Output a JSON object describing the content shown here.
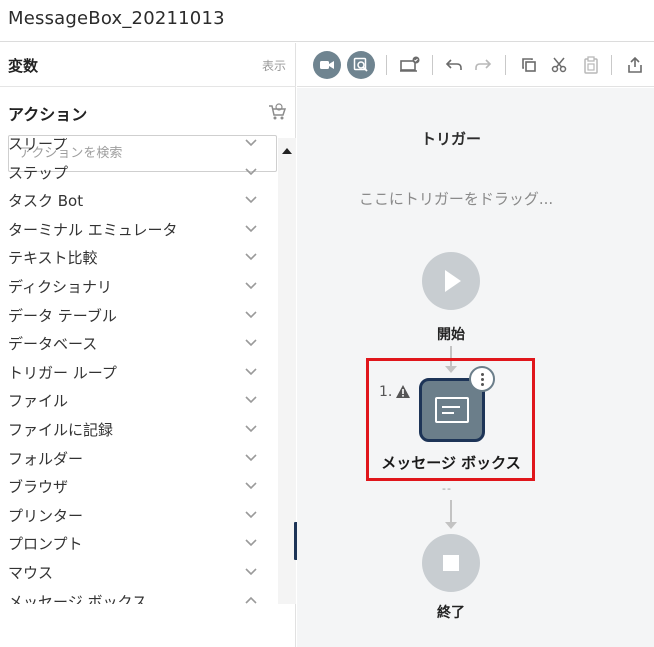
{
  "window": {
    "title": "MessageBox_20211013"
  },
  "variables": {
    "label": "変数",
    "show_label": "表示"
  },
  "actions": {
    "title": "アクション",
    "search_placeholder": "アクションを検索",
    "items": [
      {
        "label": "スリープ",
        "state": "collapsed"
      },
      {
        "label": "ステップ",
        "state": "collapsed"
      },
      {
        "label": "タスク Bot",
        "state": "collapsed"
      },
      {
        "label": "ターミナル エミュレータ",
        "state": "collapsed"
      },
      {
        "label": "テキスト比較",
        "state": "collapsed"
      },
      {
        "label": "ディクショナリ",
        "state": "collapsed"
      },
      {
        "label": "データ テーブル",
        "state": "collapsed"
      },
      {
        "label": "データベース",
        "state": "collapsed"
      },
      {
        "label": "トリガー ループ",
        "state": "collapsed"
      },
      {
        "label": "ファイル",
        "state": "collapsed"
      },
      {
        "label": "ファイルに記録",
        "state": "collapsed"
      },
      {
        "label": "フォルダー",
        "state": "collapsed"
      },
      {
        "label": "ブラウザ",
        "state": "collapsed"
      },
      {
        "label": "プリンター",
        "state": "collapsed"
      },
      {
        "label": "プロンプト",
        "state": "collapsed"
      },
      {
        "label": "マウス",
        "state": "collapsed"
      },
      {
        "label": "メッセージ ボックス",
        "state": "expanded"
      }
    ]
  },
  "toolbar": {
    "buttons": [
      "record-icon",
      "record-search-icon",
      "upload-toolbar-icon",
      "undo-icon",
      "redo-icon",
      "copy-icon",
      "cut-icon",
      "paste-icon",
      "export-icon"
    ]
  },
  "canvas": {
    "trigger_title": "トリガー",
    "trigger_hint": "ここにトリガーをドラッグ...",
    "start_label": "開始",
    "step": {
      "number": "1.",
      "label": "メッセージ ボックス",
      "dash": "--"
    },
    "end_label": "終了"
  },
  "colors": {
    "accent_dark": "#1d3457",
    "node_gray": "#c8cdd1",
    "step_fill": "#6b7e8a",
    "highlight": "#e0161b"
  }
}
